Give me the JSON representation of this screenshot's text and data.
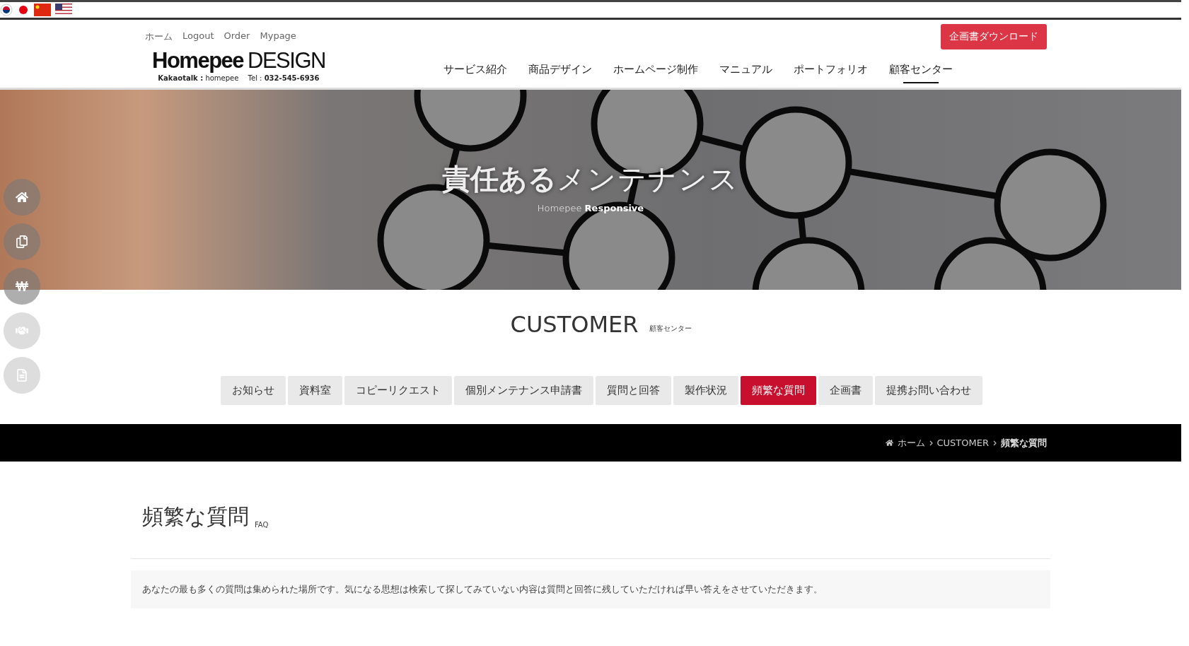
{
  "top_links": [
    "ホーム",
    "Logout",
    "Order",
    "Mypage"
  ],
  "logo": {
    "name_bold": "Homepee",
    "name_light": "DESIGN",
    "contact": "**Kakaotalk :** homepee　 Tel :  **032-545-6936**"
  },
  "download_button": "企画書ダウンロード",
  "nav": [
    {
      "label": "サービス紹介",
      "selected": false
    },
    {
      "label": "商品デザイン",
      "selected": false
    },
    {
      "label": "ホームページ制作",
      "selected": false
    },
    {
      "label": "マニュアル",
      "selected": false
    },
    {
      "label": "ポートフォリオ",
      "selected": false
    },
    {
      "label": "顧客センター",
      "selected": true
    }
  ],
  "hero": {
    "title_bold": "責任ある",
    "title_light": "メンテナンス",
    "subtitle_light": "Homepee",
    "subtitle_bold": "Responsive"
  },
  "section": {
    "title": "CUSTOMER",
    "subtitle": "顧客センター"
  },
  "tabs": [
    {
      "label": "お知らせ",
      "selected": false
    },
    {
      "label": "資料室",
      "selected": false
    },
    {
      "label": "コピーリクエスト",
      "selected": false
    },
    {
      "label": "個別メンテナンス申請書",
      "selected": false
    },
    {
      "label": "質問と回答",
      "selected": false
    },
    {
      "label": "製作状況",
      "selected": false
    },
    {
      "label": "頻繁な質問",
      "selected": true
    },
    {
      "label": "企画書",
      "selected": false
    },
    {
      "label": "提携お問い合わせ",
      "selected": false
    }
  ],
  "breadcrumb": {
    "home": "ホーム",
    "items": [
      "CUSTOMER",
      "頻繁な質問"
    ]
  },
  "page": {
    "title": "頻繁な質問",
    "tag": "FAQ",
    "description": "あなたの最も多くの質問は集められた場所です。気になる思想は検索して探してみていない内容は質問と回答に残していただければ早い答えをさせていただきます。"
  }
}
